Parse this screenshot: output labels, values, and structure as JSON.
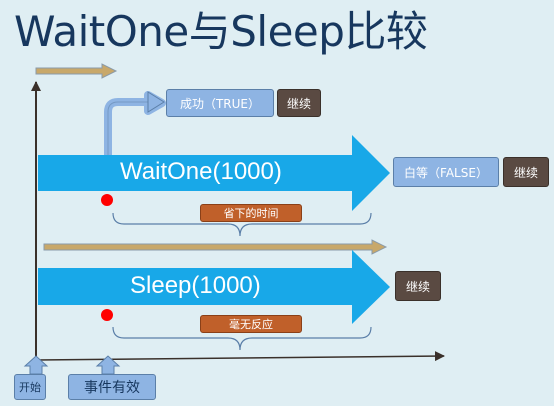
{
  "title": "WaitOne与Sleep比较",
  "waitone": {
    "arrow_label": "WaitOne(1000)",
    "success_label": "成功（TRUE）",
    "success_continue": "继续",
    "timeout_label": "白等（FALSE）",
    "timeout_continue": "继续",
    "saved_time_label": "省下的时间"
  },
  "sleep": {
    "arrow_label": "Sleep(1000)",
    "continue_label": "继续",
    "no_response_label": "毫无反应"
  },
  "axis_markers": {
    "start": "开始",
    "event_valid": "事件有效"
  },
  "colors": {
    "background": "#dfeef3",
    "title": "#17375e",
    "big_arrow": "#18a8e8",
    "thin_arrow": "#c8a86a",
    "blue_box": "#8eb4e3",
    "dark_box": "#5a4a42",
    "orange_box": "#c0602a",
    "red_dot": "#ff0000",
    "axis": "#3a302a"
  }
}
